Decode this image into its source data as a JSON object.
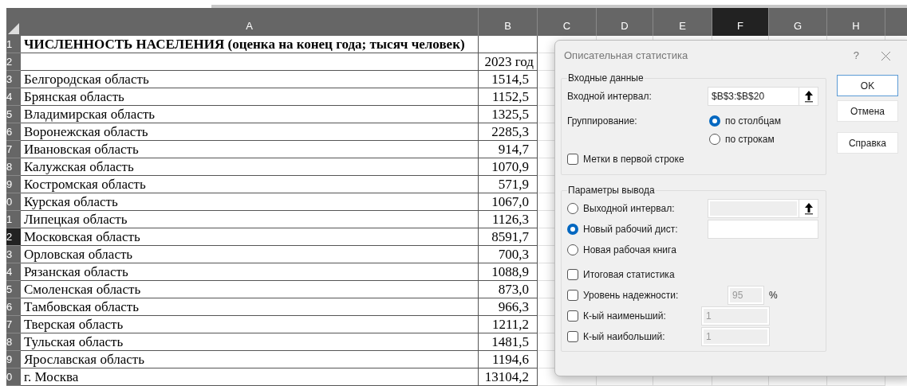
{
  "sheet": {
    "columns": [
      {
        "label": "A",
        "selected": false
      },
      {
        "label": "B",
        "selected": false
      },
      {
        "label": "C",
        "selected": false
      },
      {
        "label": "D",
        "selected": false
      },
      {
        "label": "E",
        "selected": false
      },
      {
        "label": "F",
        "selected": true
      },
      {
        "label": "G",
        "selected": false
      },
      {
        "label": "H",
        "selected": false
      }
    ],
    "rows": [
      {
        "number": "1",
        "selected": false,
        "a": "ЧИСЛЕННОСТЬ НАСЕЛЕНИЯ (оценка на конец года; тысяч человек)",
        "kind": "title"
      },
      {
        "number": "2",
        "selected": false,
        "b": "2023 год",
        "kind": "header"
      },
      {
        "number": "3",
        "selected": false,
        "a": "Белгородская область",
        "b": "1514,5",
        "kind": "data"
      },
      {
        "number": "4",
        "selected": false,
        "a": "Брянская область",
        "b": "1152,5",
        "kind": "data"
      },
      {
        "number": "5",
        "selected": false,
        "a": "Владимирская область",
        "b": "1325,5",
        "kind": "data"
      },
      {
        "number": "6",
        "selected": false,
        "a": "Воронежская область",
        "b": "2285,3",
        "kind": "data"
      },
      {
        "number": "7",
        "selected": false,
        "a": "Ивановская область",
        "b": "914,7",
        "kind": "data"
      },
      {
        "number": "8",
        "selected": false,
        "a": "Калужская область",
        "b": "1070,9",
        "kind": "data"
      },
      {
        "number": "9",
        "selected": false,
        "a": "Костромская область",
        "b": "571,9",
        "kind": "data"
      },
      {
        "number": "0",
        "selected": false,
        "a": "Курская область",
        "b": "1067,0",
        "kind": "data"
      },
      {
        "number": "1",
        "selected": false,
        "a": "Липецкая область",
        "b": "1126,3",
        "kind": "data"
      },
      {
        "number": "2",
        "selected": true,
        "a": "Московская область",
        "b": "8591,7",
        "kind": "data"
      },
      {
        "number": "3",
        "selected": false,
        "a": "Орловская область",
        "b": "700,3",
        "kind": "data"
      },
      {
        "number": "4",
        "selected": false,
        "a": "Рязанская область",
        "b": "1088,9",
        "kind": "data"
      },
      {
        "number": "5",
        "selected": false,
        "a": "Смоленская область",
        "b": "873,0",
        "kind": "data"
      },
      {
        "number": "6",
        "selected": false,
        "a": "Тамбовская область",
        "b": "966,3",
        "kind": "data"
      },
      {
        "number": "7",
        "selected": false,
        "a": "Тверская область",
        "b": "1211,2",
        "kind": "data"
      },
      {
        "number": "8",
        "selected": false,
        "a": "Тульская область",
        "b": "1481,5",
        "kind": "data"
      },
      {
        "number": "9",
        "selected": false,
        "a": "Ярославская область",
        "b": "1194,6",
        "kind": "data"
      },
      {
        "number": "0",
        "selected": false,
        "a": "г. Москва",
        "b": "13104,2",
        "kind": "data"
      }
    ]
  },
  "dialog": {
    "title": "Описательная статистика",
    "help": "?",
    "input_group": {
      "legend": "Входные данные",
      "range_label": "Входной интервал:",
      "range_value": "$B$3:$B$20",
      "grouping_label": "Группирование:",
      "grouping_options": [
        {
          "label": "по столбцам",
          "selected": true
        },
        {
          "label": "по строкам",
          "selected": false
        }
      ],
      "labels_checkbox": {
        "label": "Метки в первой строке",
        "checked": false
      }
    },
    "output_group": {
      "legend": "Параметры вывода",
      "options": [
        {
          "label": "Выходной интервал:",
          "selected": false,
          "kind": "range"
        },
        {
          "label": "Новый рабочий дист:",
          "selected": true,
          "kind": "text"
        },
        {
          "label": "Новая рабочая книга",
          "selected": false,
          "kind": "none"
        }
      ],
      "checks": [
        {
          "label": "Итоговая статистика",
          "checked": false,
          "kind": "plain"
        },
        {
          "label": "Уровень надежности:",
          "checked": false,
          "kind": "percent",
          "value": "95",
          "suffix": "%"
        },
        {
          "label": "К-ый наименьший:",
          "checked": false,
          "kind": "number",
          "value": "1"
        },
        {
          "label": "К-ый наибольший:",
          "checked": false,
          "kind": "number",
          "value": "1"
        }
      ]
    },
    "buttons": [
      {
        "label": "OK",
        "kind": "default"
      },
      {
        "label": "Отмена",
        "kind": "normal"
      },
      {
        "label": "Справка",
        "kind": "normal"
      }
    ]
  }
}
